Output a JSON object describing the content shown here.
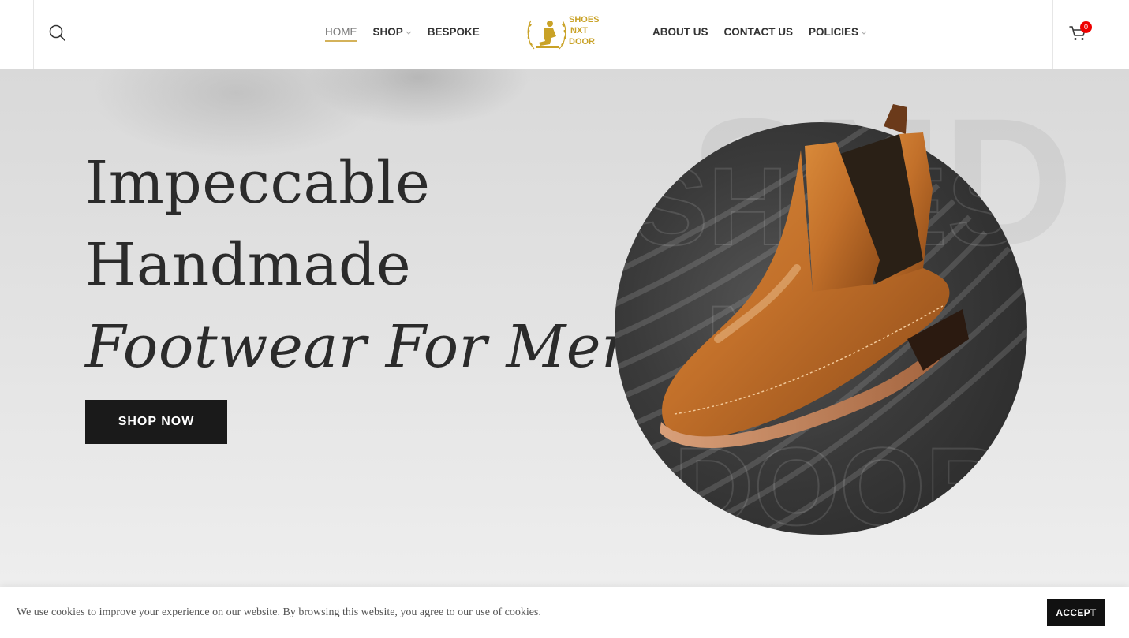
{
  "header": {
    "nav_left": [
      {
        "label": "HOME",
        "active": true,
        "has_dropdown": false
      },
      {
        "label": "SHOP",
        "active": false,
        "has_dropdown": true
      },
      {
        "label": "BESPOKE",
        "active": false,
        "has_dropdown": false
      }
    ],
    "nav_right": [
      {
        "label": "ABOUT US",
        "has_dropdown": false
      },
      {
        "label": "CONTACT US",
        "has_dropdown": false
      },
      {
        "label": "POLICIES",
        "has_dropdown": true
      }
    ],
    "logo": {
      "lines": [
        "SHOES",
        "NXT",
        "DOOR"
      ],
      "color": "#c9a227"
    },
    "search_icon": "search-icon",
    "cart": {
      "icon": "cart-icon",
      "count": "0",
      "badge_color": "#e60000"
    }
  },
  "hero": {
    "title_line1": "Impeccable",
    "title_line2": "Handmade",
    "title_line3": "Footwear For Men.",
    "cta_label": "SHOP NOW",
    "bg_words": [
      "SND",
      "SHOES",
      "N",
      "DOOR"
    ],
    "accent_color": "#d4b25a"
  },
  "cookie_bar": {
    "text": "We use cookies to improve your experience on our website. By browsing this website, you agree to our use of cookies.",
    "accept_label": "ACCEPT"
  }
}
